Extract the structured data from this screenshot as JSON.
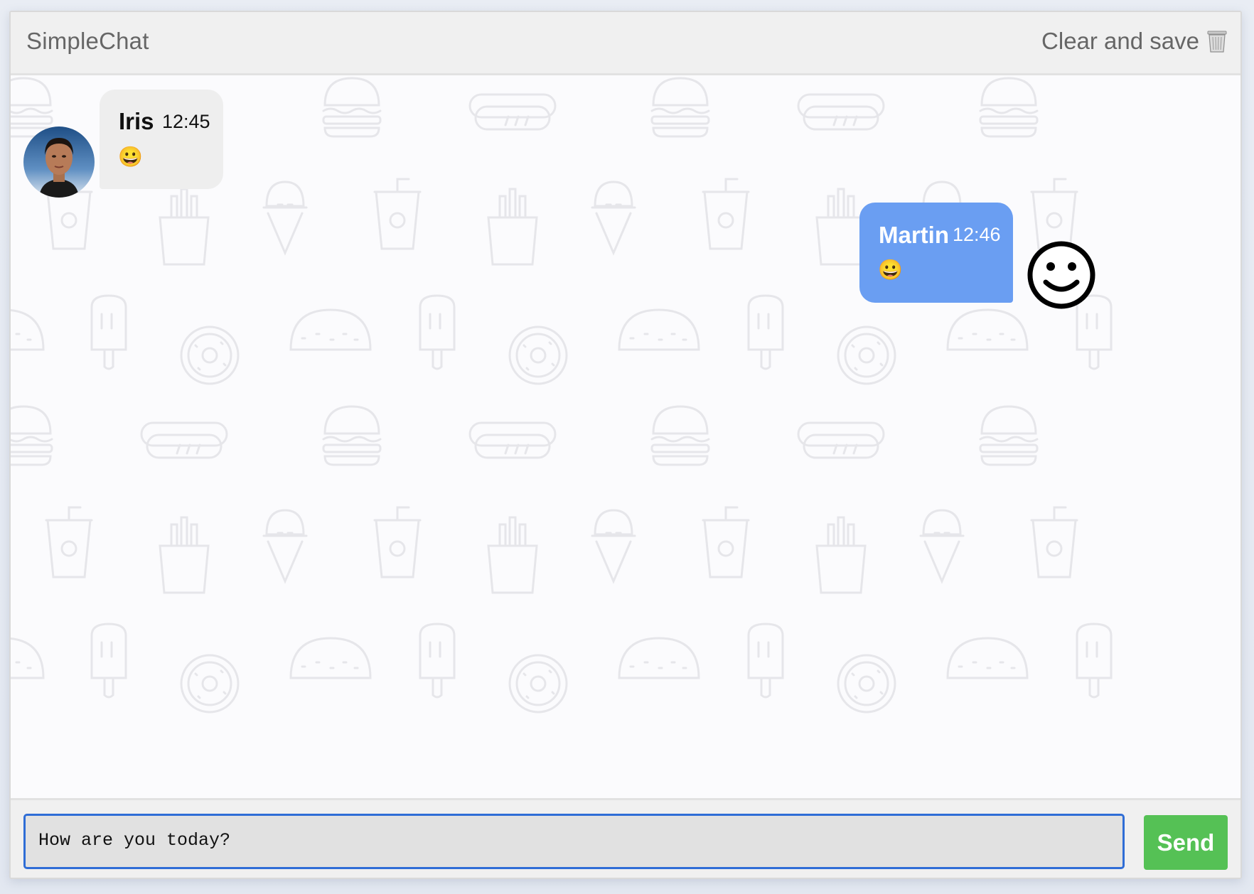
{
  "header": {
    "title": "SimpleChat",
    "clear_label": "Clear and save",
    "clear_icon": "trash-icon"
  },
  "messages": [
    {
      "sender": "Iris",
      "time": "12:45",
      "text": "😀",
      "side": "left",
      "avatar": "photo-avatar"
    },
    {
      "sender": "Martin",
      "time": "12:46",
      "text": "😀",
      "side": "right",
      "avatar": "smiley-avatar-icon"
    }
  ],
  "composer": {
    "value": "How are you today?",
    "send_label": "Send"
  },
  "colors": {
    "outgoing_bubble": "#6a9ef2",
    "incoming_bubble": "#eeeeee",
    "send_button": "#55c155",
    "input_border": "#2f6dd6"
  }
}
